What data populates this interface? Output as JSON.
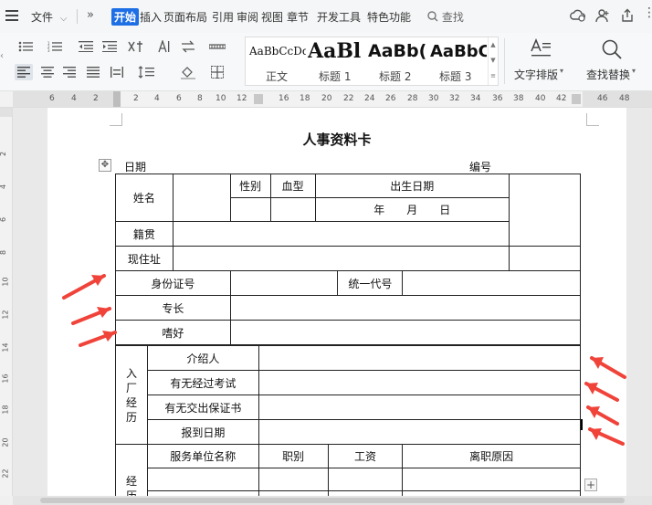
{
  "menubar": {
    "file_label": "文件",
    "tabs": [
      "开始",
      "插入",
      "页面布局",
      "引用",
      "审阅",
      "视图",
      "章节",
      "开发工具",
      "特色功能"
    ],
    "search_label": "查找"
  },
  "ribbon": {
    "styles": [
      {
        "preview": "AaBbCcDd",
        "name": "正文"
      },
      {
        "preview": "AaBl",
        "name": "标题 1"
      },
      {
        "preview": "AaBb(",
        "name": "标题 2"
      },
      {
        "preview": "AaBbC",
        "name": "标题 3"
      }
    ],
    "text_layout_label": "文字排版",
    "find_replace_label": "查找替换"
  },
  "ruler": {
    "ticks": [
      "6",
      "4",
      "2",
      "2",
      "4",
      "6",
      "8",
      "10",
      "12",
      "16",
      "18",
      "20",
      "22",
      "24",
      "26",
      "28",
      "30",
      "32",
      "34",
      "36",
      "38",
      "40",
      "42",
      "46",
      "48"
    ]
  },
  "vruler": {
    "ticks": [
      "2",
      "4",
      "6",
      "8",
      "10",
      "12",
      "14",
      "16",
      "18",
      "20",
      "22"
    ]
  },
  "document": {
    "title": "人事资料卡",
    "date_label": "日期",
    "number_label": "编号",
    "form": {
      "name": "姓名",
      "gender": "性别",
      "blood_type": "血型",
      "birth_date": "出生日期",
      "birth_ymd": "年　　月　　日",
      "native_place": "籍贯",
      "address": "现住址",
      "id_number": "身份证号",
      "unified_code": "统一代号",
      "specialty": "专长",
      "hobby": "嗜好",
      "entry_vertical": "入厂经历",
      "referrer": "介绍人",
      "exam": "有无经过考试",
      "guarantee": "有无交出保证书",
      "report_date": "报到日期",
      "work_vertical": "经历",
      "employer": "服务单位名称",
      "position": "职别",
      "salary": "工资",
      "leave_reason": "离职原因"
    }
  },
  "colors": {
    "accent": "#1e6fe6",
    "arrow": "#f0433a"
  }
}
